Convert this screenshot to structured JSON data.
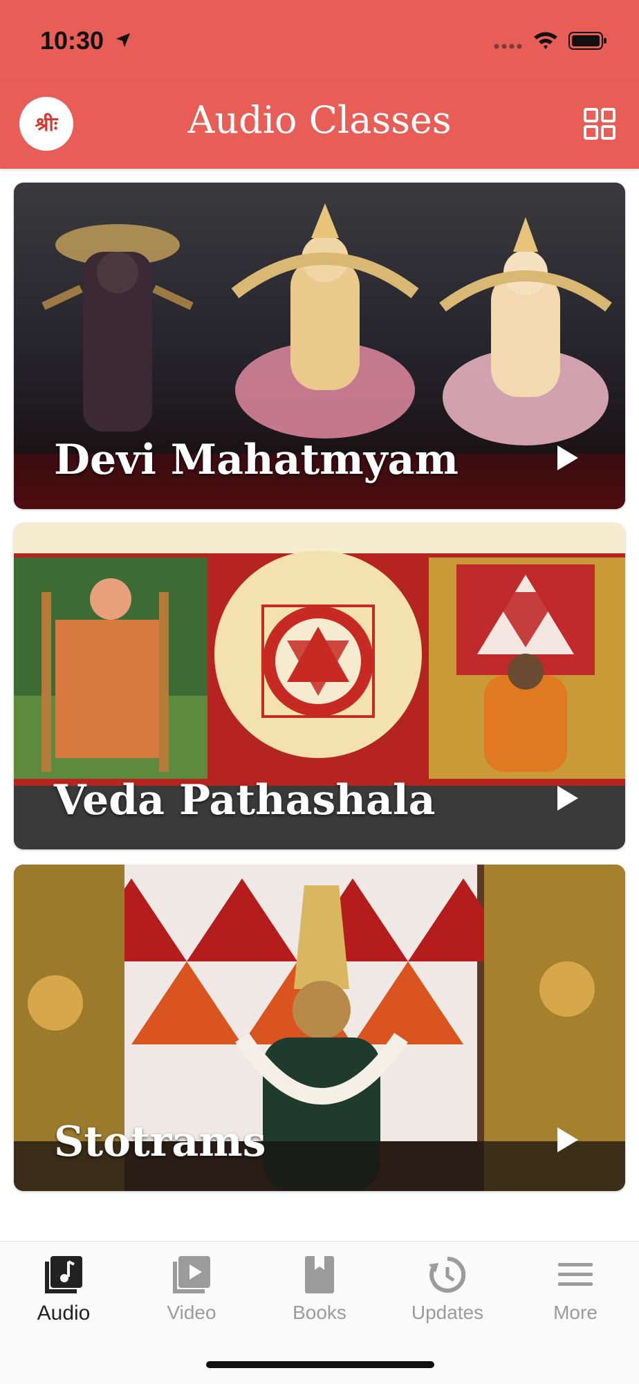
{
  "status": {
    "time": "10:30"
  },
  "header": {
    "logo_text": "श्रीः",
    "title": "Audio Classes"
  },
  "cards": [
    {
      "title": "Devi Mahatmyam"
    },
    {
      "title": "Veda Pathashala"
    },
    {
      "title": "Stotrams"
    }
  ],
  "tabs": [
    {
      "label": "Audio",
      "icon": "music-note-icon",
      "active": true
    },
    {
      "label": "Video",
      "icon": "video-play-icon",
      "active": false
    },
    {
      "label": "Books",
      "icon": "book-icon",
      "active": false
    },
    {
      "label": "Updates",
      "icon": "history-icon",
      "active": false
    },
    {
      "label": "More",
      "icon": "hamburger-menu-icon",
      "active": false
    }
  ],
  "colors": {
    "header": "#e85d55",
    "tab_active": "#222222",
    "tab_inactive": "#9b9b9b"
  }
}
